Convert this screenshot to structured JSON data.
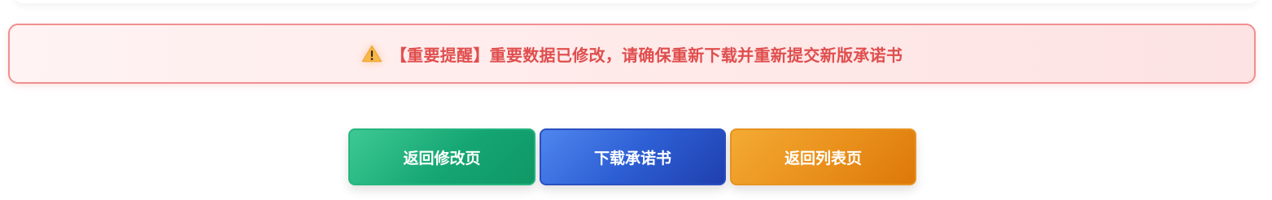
{
  "alert": {
    "icon": "warning-icon",
    "text": "【重要提醒】重要数据已修改，请确保重新下载并重新提交新版承诺书",
    "text_color": "#e04e4e",
    "border_color": "#f08f8f",
    "background_color": "#ffeaea"
  },
  "actions": {
    "back_to_edit_label": "返回修改页",
    "download_label": "下载承诺书",
    "back_to_list_label": "返回列表页",
    "colors": {
      "back_to_edit": "#15a673",
      "download": "#2d5fd4",
      "back_to_list": "#ea921d"
    }
  }
}
